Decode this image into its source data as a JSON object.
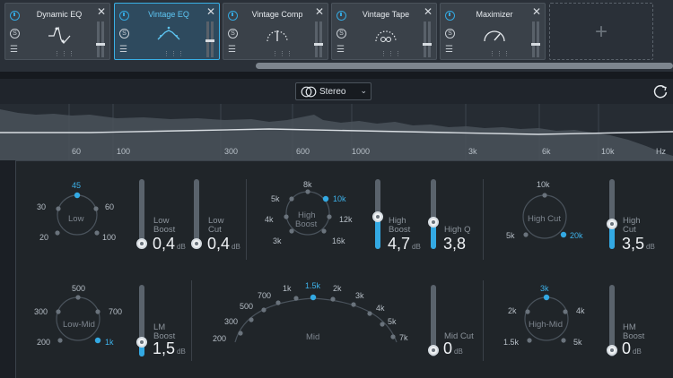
{
  "modules": [
    {
      "title": "Dynamic EQ",
      "icon": "dynamic-eq-icon"
    },
    {
      "title": "Vintage EQ",
      "icon": "vintage-eq-icon",
      "active": true
    },
    {
      "title": "Vintage Comp",
      "icon": "vintage-comp-icon"
    },
    {
      "title": "Vintage Tape",
      "icon": "vintage-tape-icon"
    },
    {
      "title": "Maximizer",
      "icon": "maximizer-icon"
    }
  ],
  "module_glyphs": {
    "close": "✕",
    "solo": "S",
    "list": "☰",
    "dots": "⋮⋮⋮",
    "add": "+"
  },
  "toolbar": {
    "channel_mode": "Stereo",
    "chevron": "⌄"
  },
  "spectrum": {
    "freq_labels": [
      "60",
      "100",
      "300",
      "600",
      "1000",
      "3k",
      "6k",
      "10k",
      "Hz"
    ]
  },
  "low_band": {
    "name": "Low",
    "labels": [
      "45",
      "30",
      "60",
      "20",
      "100"
    ],
    "selected": "45",
    "low_boost": {
      "name_line1": "Low",
      "name_line2": "Boost",
      "value": "0,4",
      "unit": "dB",
      "level": 0.0
    },
    "low_cut": {
      "name_line1": "Low",
      "name_line2": "Cut",
      "value": "0,4",
      "unit": "dB",
      "level": 0.0
    }
  },
  "high_band": {
    "name_line1": "High",
    "name_line2": "Boost",
    "labels": [
      "8k",
      "5k",
      "10k",
      "4k",
      "12k",
      "3k",
      "16k"
    ],
    "selected": "10k",
    "high_boost": {
      "name_line1": "High",
      "name_line2": "Boost",
      "value": "4,7",
      "unit": "dB",
      "level": 0.47
    },
    "high_q": {
      "name": "High Q",
      "value": "3,8",
      "level": 0.38
    }
  },
  "high_cut_band": {
    "name": "High Cut",
    "labels": [
      "10k",
      "5k",
      "20k"
    ],
    "selected": "20k",
    "high_cut": {
      "name_line1": "High",
      "name_line2": "Cut",
      "value": "3,5",
      "unit": "dB",
      "level": 0.35
    }
  },
  "low_mid_band": {
    "name": "Low-Mid",
    "labels": [
      "500",
      "300",
      "700",
      "200",
      "1k"
    ],
    "selected": "1k",
    "lm_boost": {
      "name_line1": "LM",
      "name_line2": "Boost",
      "value": "1,5",
      "unit": "dB",
      "level": 0.15
    }
  },
  "mid_band": {
    "name": "Mid",
    "labels": [
      "1k",
      "1.5k",
      "2k",
      "700",
      "3k",
      "500",
      "4k",
      "300",
      "5k",
      "200",
      "7k"
    ],
    "selected": "1.5k",
    "mid_cut": {
      "name": "Mid Cut",
      "value": "0",
      "unit": "dB",
      "level": 0.0
    }
  },
  "high_mid_band": {
    "name": "High-Mid",
    "labels": [
      "3k",
      "2k",
      "4k",
      "1.5k",
      "5k"
    ],
    "selected": "3k",
    "hm_boost": {
      "name_line1": "HM",
      "name_line2": "Boost",
      "value": "0",
      "unit": "dB",
      "level": 0.0
    }
  },
  "colors": {
    "accent": "#33a9e3",
    "panel": "#202529",
    "module": "#3a4149"
  }
}
